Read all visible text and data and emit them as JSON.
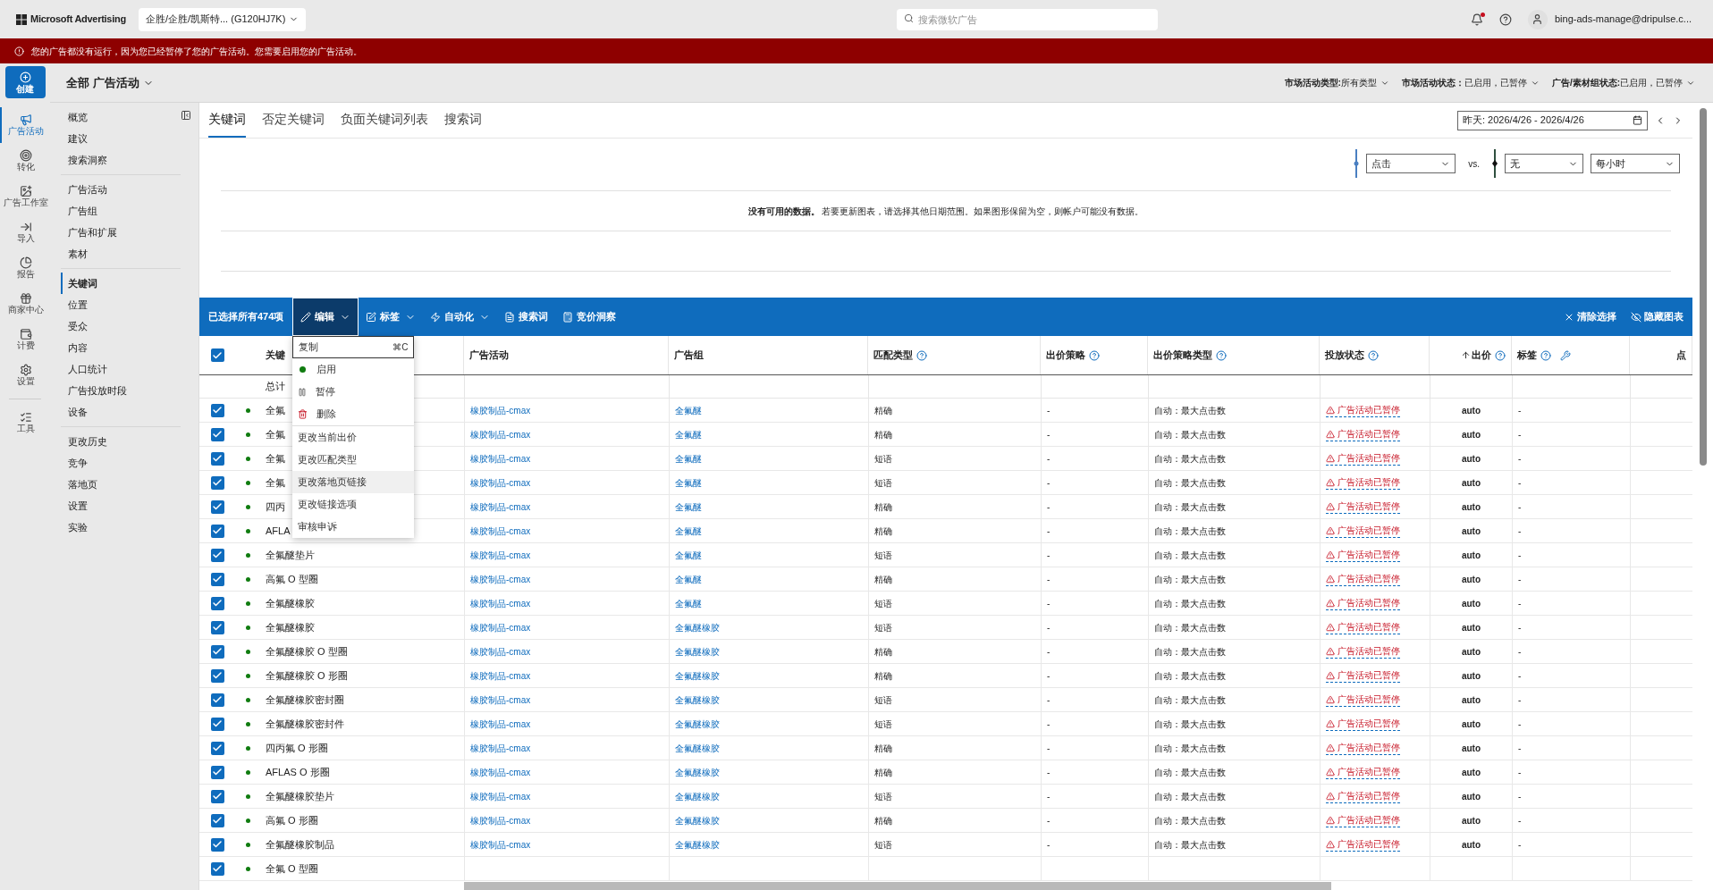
{
  "top_bar": {
    "brand": "Microsoft Advertising",
    "account": "企胜/企胜/凯斯特... (G120HJ7K)",
    "search": {
      "placeholder": "搜索微软广告"
    },
    "notifications_unread": true,
    "user": "bing-ads-manage@dripulse.c..."
  },
  "banner": {
    "message": "您的广告都没有运行，因为您已经暂停了您的广告活动。您需要启用您的广告活动。"
  },
  "rail": {
    "create": "创建",
    "items": [
      {
        "kind": "campaigns",
        "label": "广告活动",
        "selected": true
      },
      {
        "kind": "conversions",
        "label": "转化",
        "selected": false
      },
      {
        "kind": "studio",
        "label": "广告工作室",
        "selected": false
      },
      {
        "kind": "import",
        "label": "导入",
        "selected": false
      },
      {
        "kind": "reports",
        "label": "报告",
        "selected": false
      },
      {
        "kind": "merchant",
        "label": "商家中心",
        "selected": false
      },
      {
        "kind": "billing",
        "label": "计费",
        "selected": false
      },
      {
        "kind": "settings",
        "label": "设置",
        "selected": false
      },
      {
        "kind": "tools",
        "label": "工具",
        "selected": false
      }
    ]
  },
  "filter_bar": {
    "scope": "全部 广告活动",
    "filters": [
      {
        "label": "市场活动类型:",
        "value": "所有类型"
      },
      {
        "label": "市场活动状态：",
        "value": "已启用，已暂停"
      },
      {
        "label": "广告/素材组状态:",
        "value": "已启用，已暂停"
      }
    ]
  },
  "sidebar": {
    "groups": [
      [
        {
          "label": "概览",
          "selected": false
        },
        {
          "label": "建议",
          "selected": false
        },
        {
          "label": "搜索洞察",
          "selected": false
        }
      ],
      [
        {
          "label": "广告活动",
          "selected": false
        },
        {
          "label": "广告组",
          "selected": false
        },
        {
          "label": "广告和扩展",
          "selected": false
        },
        {
          "label": "素材",
          "selected": false
        }
      ],
      [
        {
          "label": "关键词",
          "selected": true
        },
        {
          "label": "位置",
          "selected": false
        },
        {
          "label": "受众",
          "selected": false
        },
        {
          "label": "内容",
          "selected": false
        },
        {
          "label": "人口统计",
          "selected": false
        },
        {
          "label": "广告投放时段",
          "selected": false
        },
        {
          "label": "设备",
          "selected": false
        }
      ],
      [
        {
          "label": "更改历史",
          "selected": false
        },
        {
          "label": "竞争",
          "selected": false
        },
        {
          "label": "落地页",
          "selected": false
        },
        {
          "label": "设置",
          "selected": false
        },
        {
          "label": "实验",
          "selected": false
        }
      ]
    ]
  },
  "tabs": [
    {
      "label": "关键词",
      "selected": true
    },
    {
      "label": "否定关键词",
      "selected": false
    },
    {
      "label": "负面关键词列表",
      "selected": false
    },
    {
      "label": "搜索词",
      "selected": false
    }
  ],
  "date_range": "昨天: 2026/4/26 - 2026/4/26",
  "chart": {
    "metric1": "点击",
    "vs": "vs.",
    "metric2": "无",
    "interval": "每小时",
    "message": "**没有可用的数据。** 若要更新图表，请选择其他日期范围。如果图形保留为空，则帐户可能没有数据。"
  },
  "toolbar": {
    "selection": "已选择所有474项",
    "buttons": [
      {
        "kind": "edit",
        "label": "编辑",
        "dropdown": true,
        "expanded": true
      },
      {
        "kind": "labels",
        "label": "标签",
        "dropdown": true,
        "expanded": false
      },
      {
        "kind": "automation",
        "label": "自动化",
        "dropdown": true,
        "expanded": false
      },
      {
        "kind": "search_terms",
        "label": "搜索词",
        "dropdown": false,
        "expanded": false
      },
      {
        "kind": "auction",
        "label": "竞价洞察",
        "dropdown": false,
        "expanded": false
      }
    ],
    "right": [
      {
        "kind": "clear",
        "label": "清除选择"
      },
      {
        "kind": "hide_chart",
        "label": "隐藏图表"
      }
    ]
  },
  "edit_menu": {
    "groups": [
      [
        {
          "kind": "copy",
          "label": "复制",
          "shortcut": "⌘C",
          "focused": true,
          "highlighted": false
        }
      ],
      [
        {
          "kind": "enable",
          "label": "启用",
          "focused": false,
          "highlighted": false
        },
        {
          "kind": "pause",
          "label": "暂停",
          "focused": false,
          "highlighted": false
        },
        {
          "kind": "delete",
          "label": "删除",
          "focused": false,
          "highlighted": false
        }
      ],
      [
        {
          "kind": "action",
          "label": "更改当前出价",
          "focused": false,
          "highlighted": false
        },
        {
          "kind": "action",
          "label": "更改匹配类型",
          "focused": false,
          "highlighted": false
        },
        {
          "kind": "action",
          "label": "更改落地页链接",
          "focused": false,
          "highlighted": true
        },
        {
          "kind": "action",
          "label": "更改链接选项",
          "focused": false,
          "highlighted": false
        },
        {
          "kind": "action",
          "label": "审核申诉",
          "focused": false,
          "highlighted": false
        }
      ]
    ]
  },
  "table": {
    "all_checked": true,
    "column_chooser": true,
    "columns": [
      {
        "label": "关键",
        "help": false,
        "sorted": false
      },
      {
        "label": "广告活动",
        "help": false,
        "sorted": false
      },
      {
        "label": "广告组",
        "help": false,
        "sorted": false
      },
      {
        "label": "匹配类型",
        "help": true,
        "sorted": false
      },
      {
        "label": "出价策略",
        "help": true,
        "sorted": false
      },
      {
        "label": "出价策略类型",
        "help": true,
        "sorted": false
      },
      {
        "label": "投放状态",
        "help": true,
        "sorted": false
      },
      {
        "label": "出价",
        "help": true,
        "sorted": true
      },
      {
        "label": "标签",
        "help": true,
        "sorted": false
      },
      {
        "label": "点",
        "help": false,
        "sorted": false
      }
    ],
    "total": "总计",
    "rows": [
      {
        "checked": true,
        "keyword": "全氟",
        "campaign": "橡胶制品-cmax",
        "ad_group": "全氟醚",
        "match_type": "精确",
        "bid_strategy": "-",
        "bid_strategy_type": "自动：最大点击数",
        "delivery": "广告活动已暂停",
        "bid": "auto",
        "labels": "-"
      },
      {
        "checked": true,
        "keyword": "全氟",
        "campaign": "橡胶制品-cmax",
        "ad_group": "全氟醚",
        "match_type": "精确",
        "bid_strategy": "-",
        "bid_strategy_type": "自动：最大点击数",
        "delivery": "广告活动已暂停",
        "bid": "auto",
        "labels": "-"
      },
      {
        "checked": true,
        "keyword": "全氟",
        "campaign": "橡胶制品-cmax",
        "ad_group": "全氟醚",
        "match_type": "短语",
        "bid_strategy": "-",
        "bid_strategy_type": "自动：最大点击数",
        "delivery": "广告活动已暂停",
        "bid": "auto",
        "labels": "-"
      },
      {
        "checked": true,
        "keyword": "全氟",
        "campaign": "橡胶制品-cmax",
        "ad_group": "全氟醚",
        "match_type": "短语",
        "bid_strategy": "-",
        "bid_strategy_type": "自动：最大点击数",
        "delivery": "广告活动已暂停",
        "bid": "auto",
        "labels": "-"
      },
      {
        "checked": true,
        "keyword": "四丙",
        "campaign": "橡胶制品-cmax",
        "ad_group": "全氟醚",
        "match_type": "精确",
        "bid_strategy": "-",
        "bid_strategy_type": "自动：最大点击数",
        "delivery": "广告活动已暂停",
        "bid": "auto",
        "labels": "-"
      },
      {
        "checked": true,
        "keyword": "AFLA",
        "campaign": "橡胶制品-cmax",
        "ad_group": "全氟醚",
        "match_type": "精确",
        "bid_strategy": "-",
        "bid_strategy_type": "自动：最大点击数",
        "delivery": "广告活动已暂停",
        "bid": "auto",
        "labels": "-"
      },
      {
        "checked": true,
        "keyword": "全氟醚垫片",
        "campaign": "橡胶制品-cmax",
        "ad_group": "全氟醚",
        "match_type": "短语",
        "bid_strategy": "-",
        "bid_strategy_type": "自动：最大点击数",
        "delivery": "广告活动已暂停",
        "bid": "auto",
        "labels": "-"
      },
      {
        "checked": true,
        "keyword": "高氟 O 型圈",
        "campaign": "橡胶制品-cmax",
        "ad_group": "全氟醚",
        "match_type": "精确",
        "bid_strategy": "-",
        "bid_strategy_type": "自动：最大点击数",
        "delivery": "广告活动已暂停",
        "bid": "auto",
        "labels": "-"
      },
      {
        "checked": true,
        "keyword": "全氟醚橡胶",
        "campaign": "橡胶制品-cmax",
        "ad_group": "全氟醚",
        "match_type": "短语",
        "bid_strategy": "-",
        "bid_strategy_type": "自动：最大点击数",
        "delivery": "广告活动已暂停",
        "bid": "auto",
        "labels": "-"
      },
      {
        "checked": true,
        "keyword": "全氟醚橡胶",
        "campaign": "橡胶制品-cmax",
        "ad_group": "全氟醚橡胶",
        "match_type": "短语",
        "bid_strategy": "-",
        "bid_strategy_type": "自动：最大点击数",
        "delivery": "广告活动已暂停",
        "bid": "auto",
        "labels": "-"
      },
      {
        "checked": true,
        "keyword": "全氟醚橡胶 O 型圈",
        "campaign": "橡胶制品-cmax",
        "ad_group": "全氟醚橡胶",
        "match_type": "精确",
        "bid_strategy": "-",
        "bid_strategy_type": "自动：最大点击数",
        "delivery": "广告活动已暂停",
        "bid": "auto",
        "labels": "-"
      },
      {
        "checked": true,
        "keyword": "全氟醚橡胶 O 形圈",
        "campaign": "橡胶制品-cmax",
        "ad_group": "全氟醚橡胶",
        "match_type": "精确",
        "bid_strategy": "-",
        "bid_strategy_type": "自动：最大点击数",
        "delivery": "广告活动已暂停",
        "bid": "auto",
        "labels": "-"
      },
      {
        "checked": true,
        "keyword": "全氟醚橡胶密封圈",
        "campaign": "橡胶制品-cmax",
        "ad_group": "全氟醚橡胶",
        "match_type": "短语",
        "bid_strategy": "-",
        "bid_strategy_type": "自动：最大点击数",
        "delivery": "广告活动已暂停",
        "bid": "auto",
        "labels": "-"
      },
      {
        "checked": true,
        "keyword": "全氟醚橡胶密封件",
        "campaign": "橡胶制品-cmax",
        "ad_group": "全氟醚橡胶",
        "match_type": "短语",
        "bid_strategy": "-",
        "bid_strategy_type": "自动：最大点击数",
        "delivery": "广告活动已暂停",
        "bid": "auto",
        "labels": "-"
      },
      {
        "checked": true,
        "keyword": "四丙氟 O 形圈",
        "campaign": "橡胶制品-cmax",
        "ad_group": "全氟醚橡胶",
        "match_type": "精确",
        "bid_strategy": "-",
        "bid_strategy_type": "自动：最大点击数",
        "delivery": "广告活动已暂停",
        "bid": "auto",
        "labels": "-"
      },
      {
        "checked": true,
        "keyword": "AFLAS O 形圈",
        "campaign": "橡胶制品-cmax",
        "ad_group": "全氟醚橡胶",
        "match_type": "精确",
        "bid_strategy": "-",
        "bid_strategy_type": "自动：最大点击数",
        "delivery": "广告活动已暂停",
        "bid": "auto",
        "labels": "-"
      },
      {
        "checked": true,
        "keyword": "全氟醚橡胶垫片",
        "campaign": "橡胶制品-cmax",
        "ad_group": "全氟醚橡胶",
        "match_type": "短语",
        "bid_strategy": "-",
        "bid_strategy_type": "自动：最大点击数",
        "delivery": "广告活动已暂停",
        "bid": "auto",
        "labels": "-"
      },
      {
        "checked": true,
        "keyword": "高氟 O 形圈",
        "campaign": "橡胶制品-cmax",
        "ad_group": "全氟醚橡胶",
        "match_type": "精确",
        "bid_strategy": "-",
        "bid_strategy_type": "自动：最大点击数",
        "delivery": "广告活动已暂停",
        "bid": "auto",
        "labels": "-"
      },
      {
        "checked": true,
        "keyword": "全氟醚橡胶制品",
        "campaign": "橡胶制品-cmax",
        "ad_group": "全氟醚橡胶",
        "match_type": "短语",
        "bid_strategy": "-",
        "bid_strategy_type": "自动：最大点击数",
        "delivery": "广告活动已暂停",
        "bid": "auto",
        "labels": "-"
      },
      {
        "checked": true,
        "keyword": "全氟 O 型圈"
      }
    ]
  }
}
